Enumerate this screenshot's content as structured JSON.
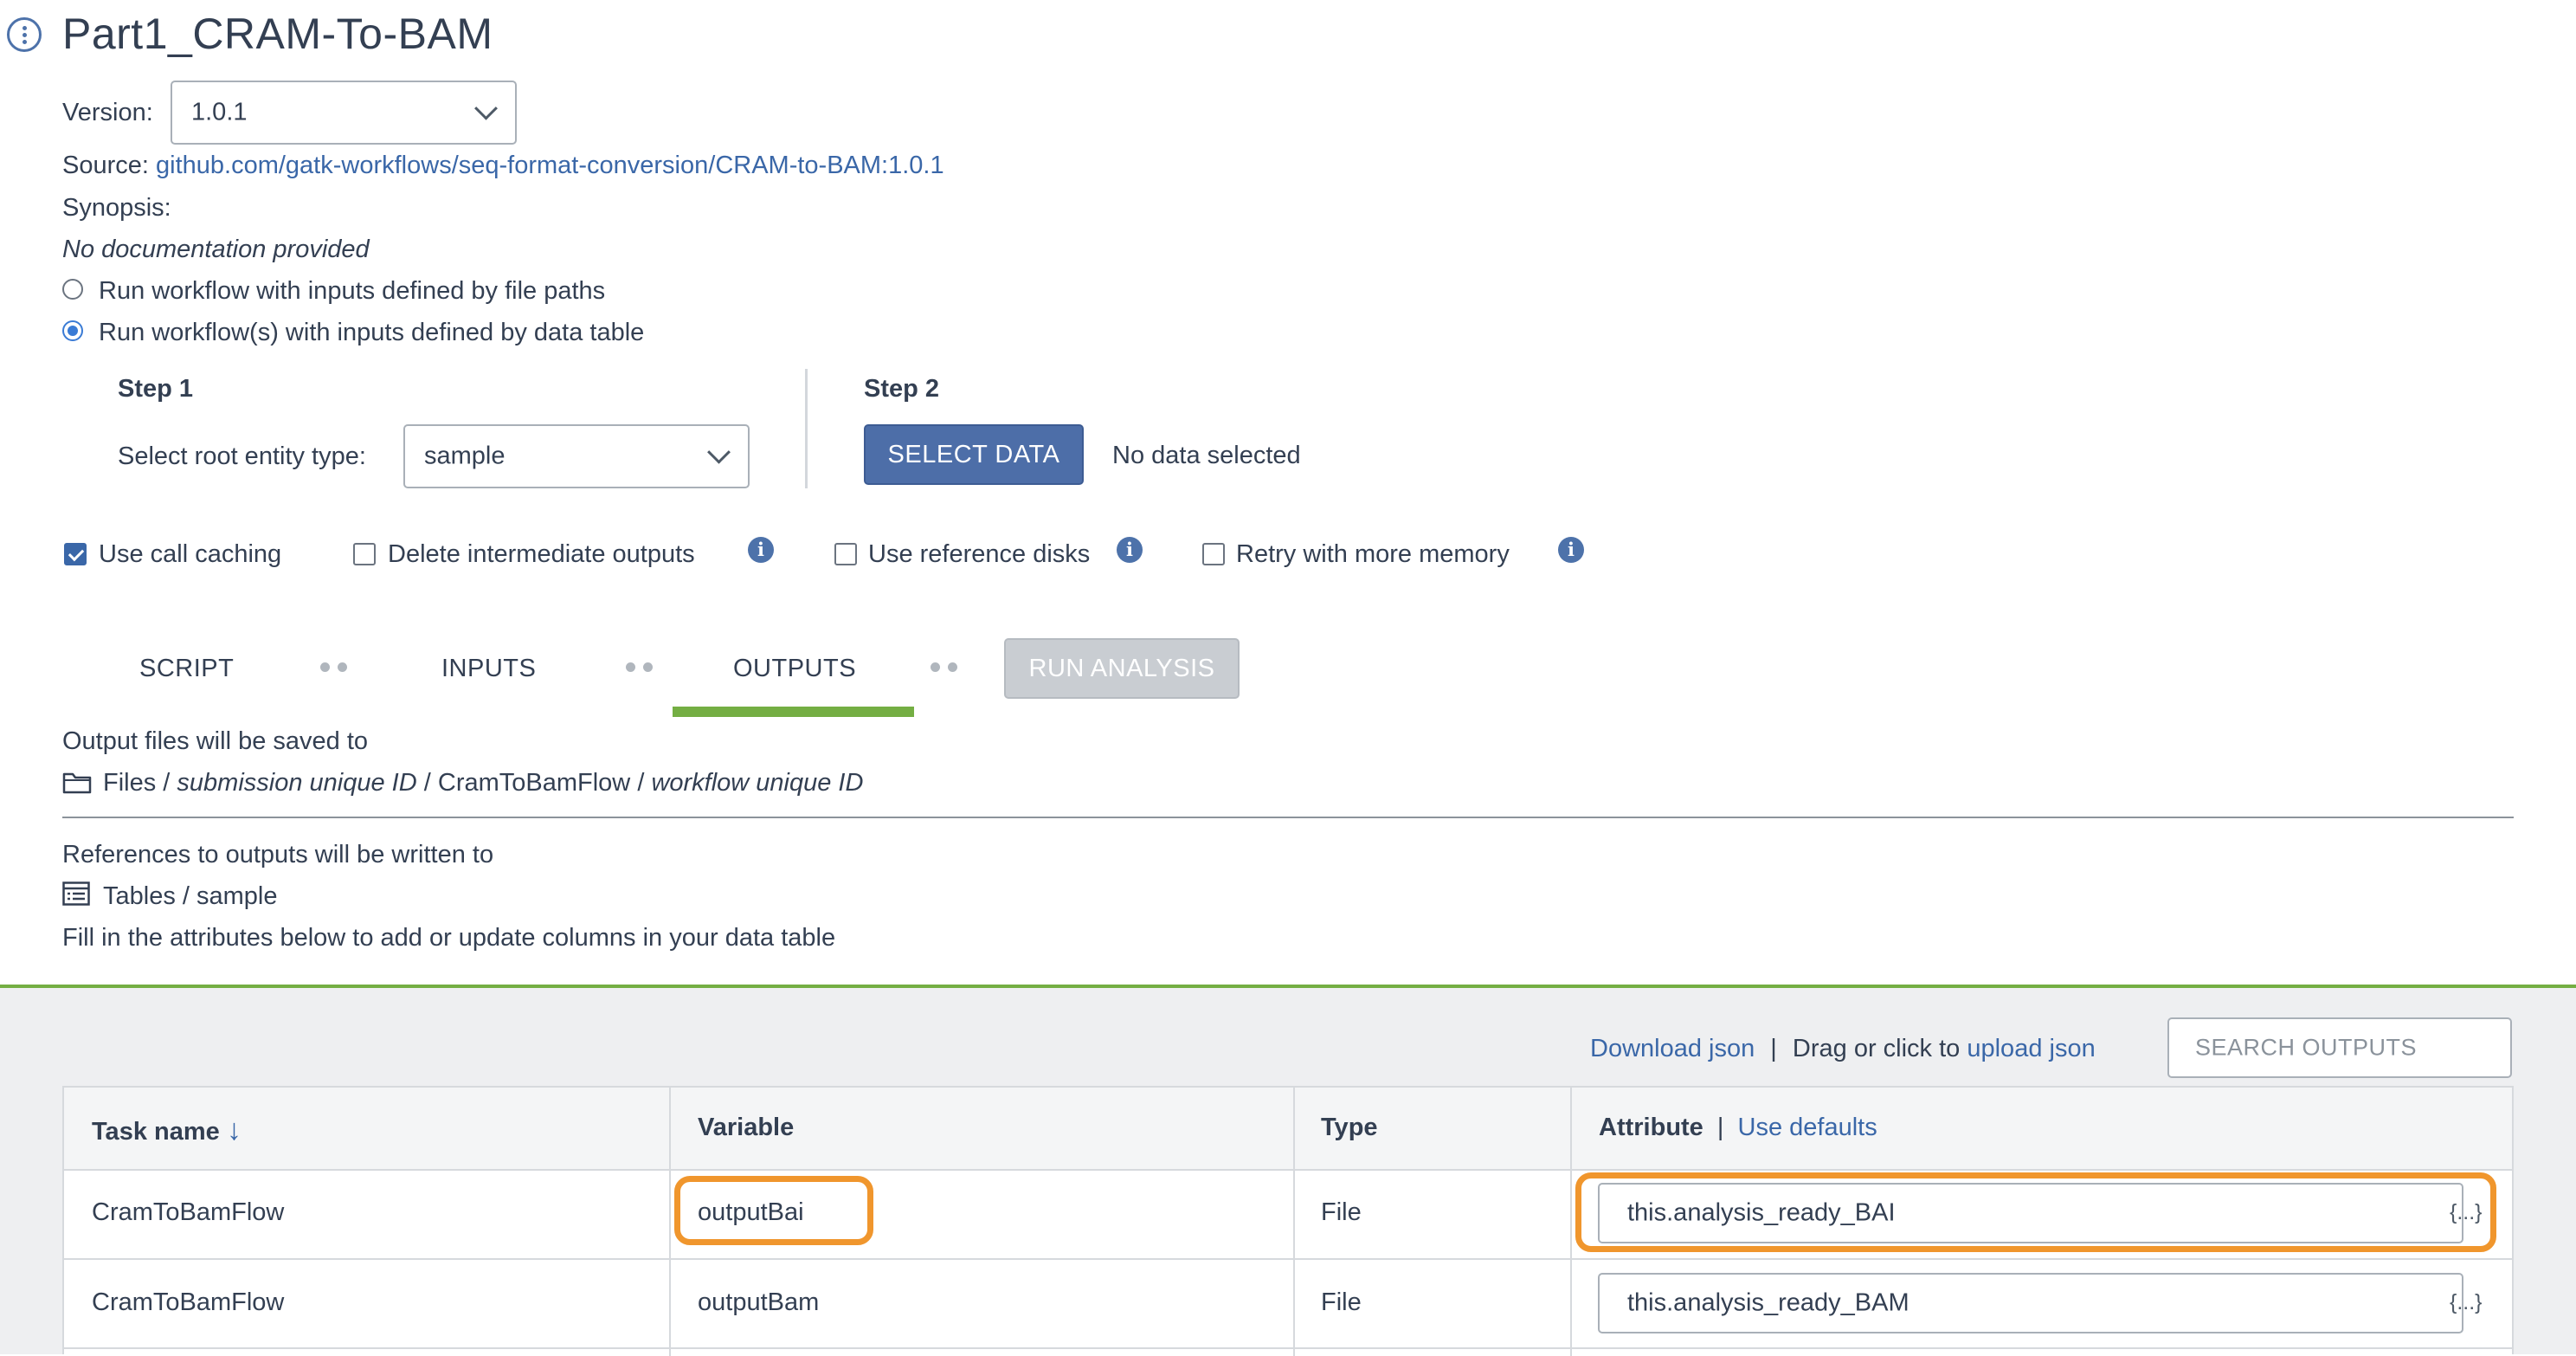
{
  "header": {
    "title": "Part1_CRAM-To-BAM"
  },
  "version": {
    "label": "Version:",
    "value": "1.0.1"
  },
  "source": {
    "label": "Source:",
    "link": "github.com/gatk-workflows/seq-format-conversion/CRAM-to-BAM:1.0.1"
  },
  "synopsis": {
    "label": "Synopsis:",
    "text": "No documentation provided"
  },
  "run_options": [
    {
      "label": "Run workflow with inputs defined by file paths",
      "selected": false
    },
    {
      "label": "Run workflow(s) with inputs defined by data table",
      "selected": true
    }
  ],
  "step1": {
    "title": "Step 1",
    "label": "Select root entity type:",
    "value": "sample"
  },
  "step2": {
    "title": "Step 2",
    "button": "SELECT DATA",
    "status": "No data selected"
  },
  "options": [
    {
      "label": "Use call caching",
      "checked": true,
      "info": false
    },
    {
      "label": "Delete intermediate outputs",
      "checked": false,
      "info": true
    },
    {
      "label": "Use reference disks",
      "checked": false,
      "info": true
    },
    {
      "label": "Retry with more memory",
      "checked": false,
      "info": true
    }
  ],
  "tabs": {
    "script": "SCRIPT",
    "inputs": "INPUTS",
    "outputs": "OUTPUTS",
    "active": "OUTPUTS",
    "run": "RUN ANALYSIS"
  },
  "output_location": {
    "intro": "Output files will be saved to",
    "files": "Files",
    "sep": "/",
    "submission": "submission unique ID",
    "flow": "CramToBamFlow",
    "workflow": "workflow unique ID"
  },
  "references": {
    "intro": "References to outputs will be written to",
    "tables": "Tables / sample",
    "hint": "Fill in the attributes below to add or update columns in your data table"
  },
  "toolbar": {
    "download": "Download json",
    "pipe": "|",
    "drag_text": "Drag or click to",
    "upload": "upload json",
    "search_placeholder": "SEARCH OUTPUTS"
  },
  "table": {
    "headers": {
      "task": "Task name",
      "sort_arrow": "↓",
      "variable": "Variable",
      "type": "Type",
      "attribute": "Attribute",
      "pipe": "|",
      "use_defaults": "Use defaults"
    },
    "rows": [
      {
        "task": "CramToBamFlow",
        "variable": "outputBai",
        "type": "File",
        "attribute": "this.analysis_ready_BAI",
        "brace": "{...}"
      },
      {
        "task": "CramToBamFlow",
        "variable": "outputBam",
        "type": "File",
        "attribute": "this.analysis_ready_BAM",
        "brace": "{...}"
      }
    ]
  },
  "colors": {
    "primary": "#4d6ea8",
    "accent_green": "#74ae43",
    "highlight": "#f0962d",
    "link": "#3a67a8"
  }
}
